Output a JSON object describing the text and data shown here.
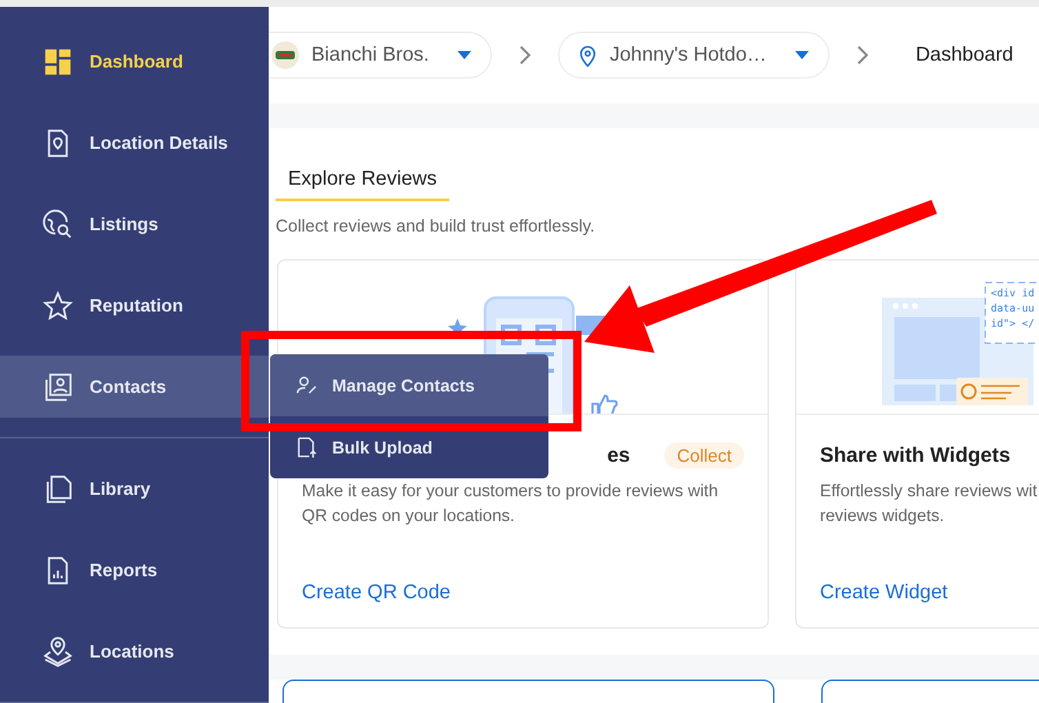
{
  "sidebar": {
    "sections": [
      [
        {
          "label": "Dashboard",
          "selected": true,
          "expanded": false
        },
        {
          "label": "Location Details",
          "selected": false,
          "expanded": false
        },
        {
          "label": "Listings",
          "selected": false,
          "expanded": false
        },
        {
          "label": "Reputation",
          "selected": false,
          "expanded": false
        },
        {
          "label": "Contacts",
          "selected": false,
          "expanded": true
        }
      ],
      [
        {
          "label": "Library",
          "selected": false,
          "expanded": false
        },
        {
          "label": "Reports",
          "selected": false,
          "expanded": false
        },
        {
          "label": "Locations",
          "selected": false,
          "expanded": false
        }
      ]
    ]
  },
  "breadcrumb": {
    "account": "Bianchi Bros.",
    "location": "Johnny's Hotdo…",
    "page": "Dashboard"
  },
  "section_tab": "Explore Reviews",
  "subtitle": "Collect reviews and build trust effortlessly.",
  "cards": [
    {
      "title": "es",
      "title_partial": true,
      "badge": "Collect",
      "description": "Make it easy for your customers to provide reviews with\nQR codes on your locations.",
      "link": "Create QR Code"
    },
    {
      "title": "Share with Widgets",
      "title_partial": false,
      "description": "Effortlessly share reviews wit\nreviews widgets.",
      "link": "Create Widget",
      "snippet": [
        "<div id",
        "data-uu",
        "id\"> </"
      ]
    }
  ],
  "contacts_menu": [
    {
      "label": "Manage Contacts",
      "selected": true
    },
    {
      "label": "Bulk Upload",
      "selected": false
    }
  ]
}
